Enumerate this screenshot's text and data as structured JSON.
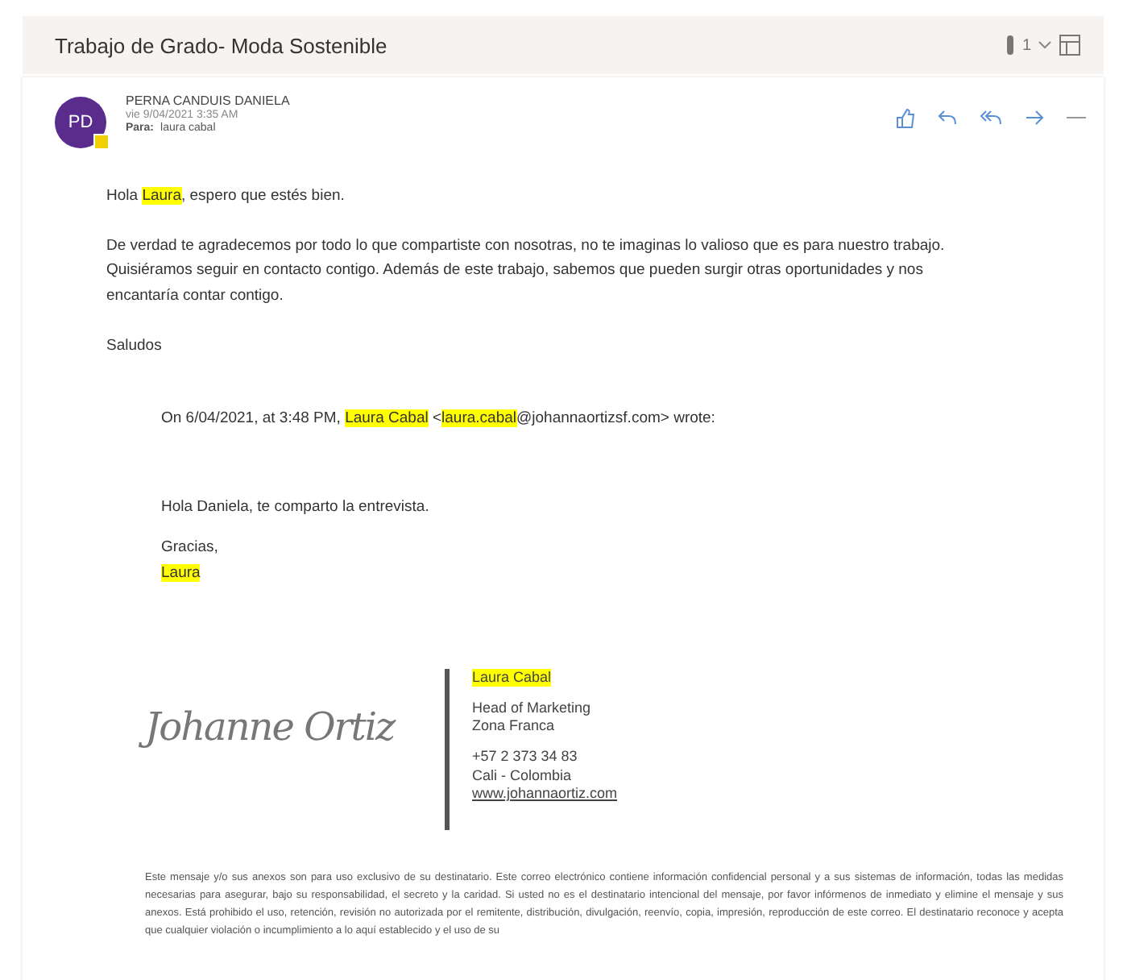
{
  "subject": "Trabajo de Grado- Moda Sostenible",
  "thread_count": "1",
  "message": {
    "avatar": "PD",
    "sender": "PERNA CANDUIS DANIELA",
    "date": "vie 9/04/2021 3:35 AM",
    "to_label": "Para:",
    "to": "laura cabal",
    "body": [
      [
        {
          "text": "Hola ",
          "highlighted": false
        },
        {
          "text": "Laura",
          "highlighted": true
        },
        {
          "text": ", espero que estés bien.",
          "highlighted": false
        }
      ],
      [
        {
          "text": "De verdad te agradecemos por todo lo que compartiste con nosotras, no te imaginas lo valioso que es para nuestro trabajo. Quisiéramos seguir en contacto contigo. Además de este trabajo, sabemos que pueden surgir otras oportunidades y nos encantaría contar contigo.",
          "highlighted": false
        }
      ],
      [
        {
          "text": "Saludos",
          "highlighted": false
        }
      ]
    ],
    "quote_header": [
      {
        "text": "On 6/04/2021, at 3:48 PM, ",
        "highlighted": false
      },
      {
        "text": "Laura Cabal",
        "highlighted": true
      },
      {
        "text": " <",
        "highlighted": false
      },
      {
        "text": "laura.cabal",
        "highlighted": true
      },
      {
        "text": "@johannaortizsf.com> wrote:",
        "highlighted": false
      }
    ],
    "quote_body": [
      [
        {
          "text": "Hola Daniela, te comparto la entrevista.",
          "highlighted": false
        }
      ],
      [
        {
          "text": "Gracias,",
          "highlighted": false
        }
      ],
      [
        {
          "text": "Laura",
          "highlighted": true
        }
      ]
    ],
    "signature": {
      "script": "Johanne Ortiz",
      "name": "Laura Cabal",
      "name_highlighted": true,
      "title": "Head of Marketing",
      "area": "Zona Franca",
      "phone": "+57 2 373 34 83",
      "city": "Cali - Colombia",
      "website": "www.johannaortiz.com"
    },
    "disclaimer": "Este mensaje y/o sus anexos son para uso exclusivo de su destinatario. Este correo electrónico contiene información confidencial personal y a sus sistemas de información, todas las medidas necesarias para asegurar, bajo su responsabilidad, el secreto y la caridad. Si usted no es el destinatario intencional del mensaje, por favor infórmenos de inmediato y elimine el mensaje y sus anexos. Está prohibido el uso, retención, revisión no autorizada por el remitente, distribución, divulgación, reenvío, copia, impresión, reproducción de este correo. El destinatario reconoce y acepta que cualquier violación o incumplimiento a lo aquí establecido y el uso de su"
  }
}
